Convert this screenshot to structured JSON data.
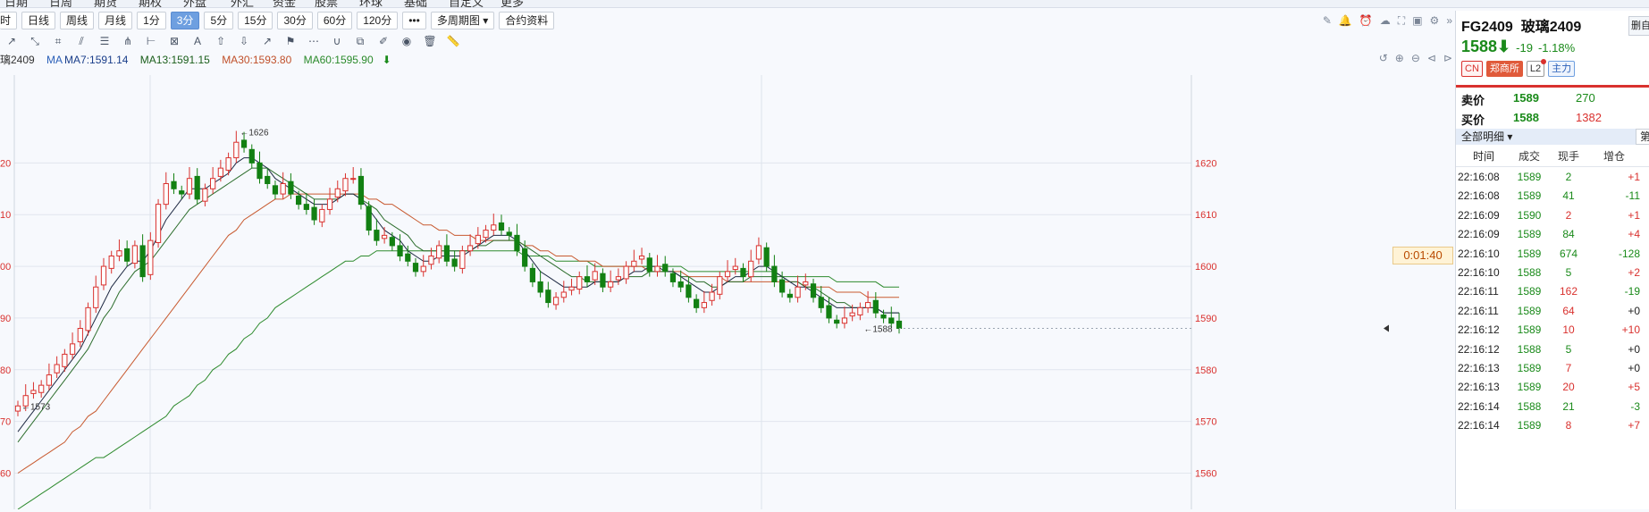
{
  "top_nav": [
    "日期",
    "日周",
    "期货",
    "期权",
    "外盘",
    "外汇",
    "资金",
    "股票",
    "环球",
    "基础",
    "自定义",
    "更多"
  ],
  "period_buttons": [
    "时",
    "日线",
    "周线",
    "月线",
    "1分",
    "3分",
    "5分",
    "15分",
    "30分",
    "60分",
    "120分"
  ],
  "active_period": "3分",
  "more_label": "•••",
  "multi_period_label": "多周期图",
  "contract_info_label": "合约资料",
  "ma_bar": {
    "symbol": "璃2409",
    "ma7": "MA7:1591.14",
    "ma13": "MA13:1591.15",
    "ma30": "MA30:1593.80",
    "ma60": "MA60:1595.90"
  },
  "timer": "0:01:40",
  "right_panel": {
    "code": "FG2409",
    "name": "玻璃2409",
    "side_button": "删自",
    "price": "1588",
    "change": "-19",
    "change_pct": "-1.18%",
    "tags": [
      "CN",
      "郑商所",
      "L2",
      "主力"
    ],
    "ask_label": "卖价",
    "ask_price": "1589",
    "ask_vol": "270",
    "bid_label": "买价",
    "bid_price": "1588",
    "bid_vol": "1382",
    "detail_label": "全部明细",
    "side_cut": "第",
    "columns": [
      "时间",
      "成交",
      "现手",
      "增仓"
    ],
    "ticks": [
      {
        "time": "22:16:08",
        "price": "1589",
        "vol": "2",
        "oi": "+1",
        "vc": "#1a8a1a",
        "oc": "#d9312e"
      },
      {
        "time": "22:16:08",
        "price": "1589",
        "vol": "41",
        "oi": "-11",
        "vc": "#1a8a1a",
        "oc": "#1a8a1a"
      },
      {
        "time": "22:16:09",
        "price": "1590",
        "vol": "2",
        "oi": "+1",
        "vc": "#d9312e",
        "oc": "#d9312e"
      },
      {
        "time": "22:16:09",
        "price": "1589",
        "vol": "84",
        "oi": "+4",
        "vc": "#1a8a1a",
        "oc": "#d9312e"
      },
      {
        "time": "22:16:10",
        "price": "1589",
        "vol": "674",
        "oi": "-128",
        "vc": "#1a8a1a",
        "oc": "#1a8a1a"
      },
      {
        "time": "22:16:10",
        "price": "1588",
        "vol": "5",
        "oi": "+2",
        "vc": "#1a8a1a",
        "oc": "#d9312e"
      },
      {
        "time": "22:16:11",
        "price": "1589",
        "vol": "162",
        "oi": "-19",
        "vc": "#d9312e",
        "oc": "#1a8a1a"
      },
      {
        "time": "22:16:11",
        "price": "1589",
        "vol": "64",
        "oi": "+0",
        "vc": "#d9312e",
        "oc": "#222222"
      },
      {
        "time": "22:16:12",
        "price": "1589",
        "vol": "10",
        "oi": "+10",
        "vc": "#d9312e",
        "oc": "#d9312e"
      },
      {
        "time": "22:16:12",
        "price": "1588",
        "vol": "5",
        "oi": "+0",
        "vc": "#1a8a1a",
        "oc": "#222222"
      },
      {
        "time": "22:16:13",
        "price": "1589",
        "vol": "7",
        "oi": "+0",
        "vc": "#d9312e",
        "oc": "#222222"
      },
      {
        "time": "22:16:13",
        "price": "1589",
        "vol": "20",
        "oi": "+5",
        "vc": "#d9312e",
        "oc": "#d9312e"
      },
      {
        "time": "22:16:14",
        "price": "1588",
        "vol": "21",
        "oi": "-3",
        "vc": "#1a8a1a",
        "oc": "#1a8a1a"
      },
      {
        "time": "22:16:14",
        "price": "1589",
        "vol": "8",
        "oi": "+7",
        "vc": "#d9312e",
        "oc": "#d9312e"
      }
    ]
  },
  "chart_data": {
    "type": "candlestick",
    "y_ticks_left": [
      "20",
      "10",
      "00",
      "90",
      "80",
      "70",
      "60"
    ],
    "y_ticks_right": [
      "1620",
      "1610",
      "1600",
      "1590",
      "1580",
      "1570",
      "1560"
    ],
    "ylim": [
      1553,
      1637
    ],
    "annotations": [
      {
        "text": "1626",
        "value": 1626
      },
      {
        "text": "1573",
        "value": 1573
      },
      {
        "text": "1588",
        "value": 1588
      }
    ],
    "closes": [
      1573,
      1575,
      1576,
      1577,
      1579,
      1581,
      1583,
      1585,
      1588,
      1592,
      1596,
      1600,
      1602,
      1603,
      1601,
      1604,
      1598,
      1605,
      1612,
      1616,
      1615,
      1614,
      1617,
      1613,
      1615,
      1617,
      1619,
      1621,
      1624,
      1623,
      1620,
      1617,
      1616,
      1614,
      1616,
      1614,
      1612,
      1611,
      1609,
      1611,
      1613,
      1615,
      1617,
      1617,
      1612,
      1607,
      1605,
      1606,
      1604,
      1602,
      1601,
      1599,
      1600,
      1602,
      1604,
      1601,
      1600,
      1603,
      1604,
      1606,
      1607,
      1608,
      1607,
      1606,
      1603,
      1600,
      1597,
      1595,
      1593,
      1594,
      1595,
      1596,
      1598,
      1597,
      1599,
      1596,
      1597,
      1598,
      1600,
      1601,
      1602,
      1599,
      1600,
      1599,
      1597,
      1596,
      1594,
      1592,
      1593,
      1595,
      1598,
      1599,
      1600,
      1598,
      1601,
      1604,
      1600,
      1597,
      1595,
      1594,
      1596,
      1597,
      1594,
      1592,
      1590,
      1589,
      1590,
      1591,
      1592,
      1593,
      1591,
      1590,
      1589,
      1588
    ],
    "ma7": [
      1568,
      1570,
      1572,
      1574,
      1576,
      1578,
      1580,
      1582,
      1584,
      1587,
      1590,
      1593,
      1596,
      1598,
      1600,
      1601,
      1601,
      1603,
      1606,
      1609,
      1611,
      1613,
      1615,
      1615,
      1615,
      1616,
      1617,
      1618,
      1620,
      1621,
      1621,
      1620,
      1619,
      1617,
      1616,
      1615,
      1614,
      1613,
      1612,
      1612,
      1612,
      1613,
      1614,
      1614,
      1613,
      1611,
      1609,
      1607,
      1606,
      1605,
      1603,
      1602,
      1601,
      1601,
      1602,
      1602,
      1602,
      1602,
      1603,
      1604,
      1605,
      1606,
      1606,
      1606,
      1605,
      1603,
      1601,
      1599,
      1598,
      1597,
      1596,
      1596,
      1596,
      1596,
      1597,
      1597,
      1597,
      1597,
      1598,
      1599,
      1599,
      1600,
      1600,
      1599,
      1599,
      1598,
      1597,
      1596,
      1595,
      1595,
      1596,
      1597,
      1598,
      1598,
      1599,
      1600,
      1600,
      1599,
      1598,
      1597,
      1596,
      1596,
      1595,
      1594,
      1593,
      1592,
      1592,
      1592,
      1592,
      1592,
      1592,
      1591,
      1591,
      1591
    ],
    "ma13": [
      1566,
      1568,
      1570,
      1572,
      1574,
      1576,
      1578,
      1580,
      1582,
      1584,
      1587,
      1590,
      1592,
      1595,
      1597,
      1599,
      1600,
      1601,
      1603,
      1605,
      1607,
      1609,
      1611,
      1612,
      1613,
      1614,
      1615,
      1616,
      1617,
      1618,
      1619,
      1619,
      1619,
      1618,
      1617,
      1616,
      1615,
      1614,
      1613,
      1613,
      1613,
      1613,
      1614,
      1614,
      1613,
      1612,
      1611,
      1609,
      1608,
      1607,
      1606,
      1604,
      1603,
      1603,
      1603,
      1603,
      1603,
      1603,
      1603,
      1604,
      1604,
      1605,
      1605,
      1605,
      1605,
      1604,
      1603,
      1602,
      1601,
      1600,
      1599,
      1598,
      1598,
      1597,
      1597,
      1597,
      1597,
      1597,
      1598,
      1598,
      1598,
      1599,
      1599,
      1599,
      1599,
      1598,
      1598,
      1597,
      1597,
      1596,
      1596,
      1597,
      1597,
      1597,
      1598,
      1598,
      1598,
      1598,
      1598,
      1597,
      1597,
      1596,
      1596,
      1595,
      1594,
      1593,
      1593,
      1592,
      1592,
      1592,
      1592,
      1591,
      1591,
      1591
    ],
    "ma30": [
      1560,
      1561,
      1562,
      1563,
      1564,
      1565,
      1566,
      1568,
      1569,
      1571,
      1572,
      1574,
      1576,
      1578,
      1580,
      1582,
      1584,
      1586,
      1588,
      1590,
      1592,
      1594,
      1596,
      1598,
      1600,
      1602,
      1604,
      1606,
      1607,
      1609,
      1610,
      1611,
      1612,
      1613,
      1613,
      1614,
      1614,
      1614,
      1614,
      1614,
      1614,
      1614,
      1614,
      1614,
      1614,
      1613,
      1613,
      1612,
      1612,
      1611,
      1610,
      1609,
      1608,
      1608,
      1607,
      1607,
      1606,
      1606,
      1606,
      1605,
      1605,
      1605,
      1605,
      1605,
      1605,
      1604,
      1604,
      1603,
      1603,
      1602,
      1602,
      1602,
      1601,
      1601,
      1601,
      1600,
      1600,
      1600,
      1600,
      1600,
      1600,
      1599,
      1599,
      1599,
      1599,
      1599,
      1598,
      1598,
      1598,
      1598,
      1598,
      1597,
      1597,
      1597,
      1597,
      1597,
      1597,
      1597,
      1597,
      1597,
      1597,
      1596,
      1596,
      1596,
      1596,
      1595,
      1595,
      1595,
      1595,
      1594,
      1594,
      1594,
      1594,
      1594
    ],
    "ma60": [
      1553,
      1554,
      1555,
      1556,
      1557,
      1558,
      1559,
      1560,
      1561,
      1562,
      1563,
      1563,
      1564,
      1565,
      1566,
      1567,
      1568,
      1569,
      1570,
      1571,
      1573,
      1574,
      1575,
      1577,
      1578,
      1580,
      1581,
      1583,
      1584,
      1586,
      1587,
      1589,
      1590,
      1592,
      1593,
      1594,
      1595,
      1596,
      1597,
      1598,
      1599,
      1600,
      1601,
      1601,
      1602,
      1602,
      1603,
      1603,
      1603,
      1603,
      1603,
      1603,
      1603,
      1603,
      1603,
      1603,
      1603,
      1603,
      1603,
      1603,
      1603,
      1603,
      1603,
      1603,
      1603,
      1602,
      1602,
      1602,
      1602,
      1601,
      1601,
      1601,
      1601,
      1601,
      1600,
      1600,
      1600,
      1600,
      1600,
      1600,
      1600,
      1600,
      1600,
      1600,
      1600,
      1600,
      1599,
      1599,
      1599,
      1599,
      1599,
      1599,
      1599,
      1599,
      1599,
      1599,
      1599,
      1599,
      1598,
      1598,
      1598,
      1598,
      1598,
      1598,
      1598,
      1597,
      1597,
      1597,
      1597,
      1597,
      1597,
      1596,
      1596,
      1596
    ]
  }
}
